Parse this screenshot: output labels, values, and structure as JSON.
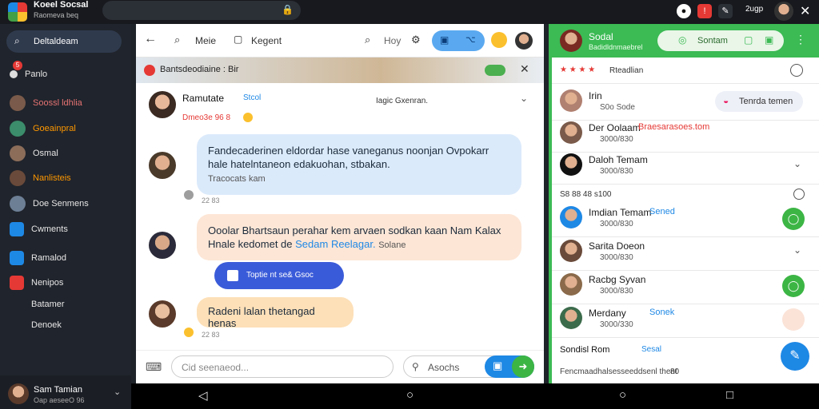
{
  "topbar": {
    "title": "Koeel Socsal",
    "subtitle": "Raomeva beq",
    "user_label": "2ugp",
    "close": "✕"
  },
  "sidebar": {
    "search_label": "Deltaldeam",
    "items": [
      {
        "label": "Panlo",
        "color": "#dddddd",
        "text_color": "#e6e6e6",
        "badge": "5"
      },
      {
        "label": "Soossl ldhlia",
        "color": "#7a5a4a",
        "text_color": "#e57373"
      },
      {
        "label": "Goeainpral",
        "color": "#3b8d6b",
        "text_color": "#ff9800"
      },
      {
        "label": "Osmal",
        "color": "#8b6d5a",
        "text_color": "#e6e6e6"
      },
      {
        "label": "Nanlisteis",
        "color": "#6a4a3a",
        "text_color": "#ff9800"
      },
      {
        "label": "Doe Senmens",
        "color": "#6d7f95",
        "text_color": "#e6e6e6"
      },
      {
        "label": "Cwments",
        "color": "#1e88e5",
        "text_color": "#e6e6e6"
      },
      {
        "label": "Ramalod",
        "color": "#1e88e5",
        "text_color": "#e6e6e6"
      },
      {
        "label": "Nenipos",
        "color": "#e53935",
        "text_color": "#e6e6e6"
      },
      {
        "label": "Batamer",
        "color": "#20242c",
        "text_color": "#e6e6e6"
      },
      {
        "label": "Denoek",
        "color": "#20242c",
        "text_color": "#e6e6e6"
      }
    ],
    "footer_name": "Sam Tamian",
    "footer_meta": "Oap aeseeO 96"
  },
  "chat": {
    "toolbar": {
      "back": "←",
      "more_label": "Meie",
      "regent_label": "Kegent",
      "search_label": "Hoy"
    },
    "banner_text": "Bantsdeodiaine : Bir",
    "header": {
      "name": "Ramutate",
      "badge": "Stcol",
      "sub": "Dmeo3e 96 8",
      "right_text": "Iagic Gxenran."
    },
    "messages": [
      {
        "text": "Fandecaderinen eldordar hase vaneganus noonjan Ovpokarr hale hatelntaneon edakuohan, stbakan.",
        "sub": "Tracocats kam",
        "time": "22 83"
      },
      {
        "text": "Ooolar Bhartsaun perahar kem arvaen sodkan kaan Nam Kalax Hnale kedomet de",
        "link": "Sedam Reelagar.",
        "tail": "Solane",
        "time": ""
      },
      {
        "text": "Radeni lalan thetangad henas",
        "time": "22 83"
      }
    ],
    "file_label": "Toptie nt se& Gsoc",
    "composer": {
      "placeholder": "Cid seenaeod...",
      "secondary_label": "Asochs"
    }
  },
  "panel": {
    "header_title": "Sodal",
    "header_sub": "Badidldnmaebrel",
    "header_button": "Sontam",
    "subheader": "Rteadlian",
    "tag_button": "Tenrda temen",
    "entries": [
      {
        "name": "Irin",
        "meta": "S0o Sode",
        "color": "#b08070"
      },
      {
        "name": "Der Oolaam",
        "link": "Braesarasoes.tom",
        "meta": "3000/830",
        "color": "#7a5a4a"
      },
      {
        "name": "Daloh Temam",
        "meta": "3000/830",
        "color": "#111111"
      },
      {
        "name": "Imdian Temam",
        "link": "Sened",
        "meta": "3000/830",
        "color": "#1e88e5"
      },
      {
        "name": "Sarita Doeon",
        "meta": "3000/830",
        "color": "#6a4a3a"
      },
      {
        "name": "Racbg Syvan",
        "meta": "3000/830",
        "color": "#8a6a4a"
      },
      {
        "name": "Merdany",
        "link": "Sonek",
        "meta": "3000/330",
        "color": "#3b6b4b"
      }
    ],
    "stats_row": "S8   88   48   s100",
    "footer_name": "Sondisl Rom",
    "footer_link": "Sesal",
    "footer_meta": "Fencmaadhalsesseeddsenl thent",
    "footer_num": "80"
  },
  "accent": {
    "blue": "#1e88e5",
    "green": "#3cba54",
    "bubble_blue": "#dbeafb",
    "bubble_peach": "#fde6d6"
  }
}
